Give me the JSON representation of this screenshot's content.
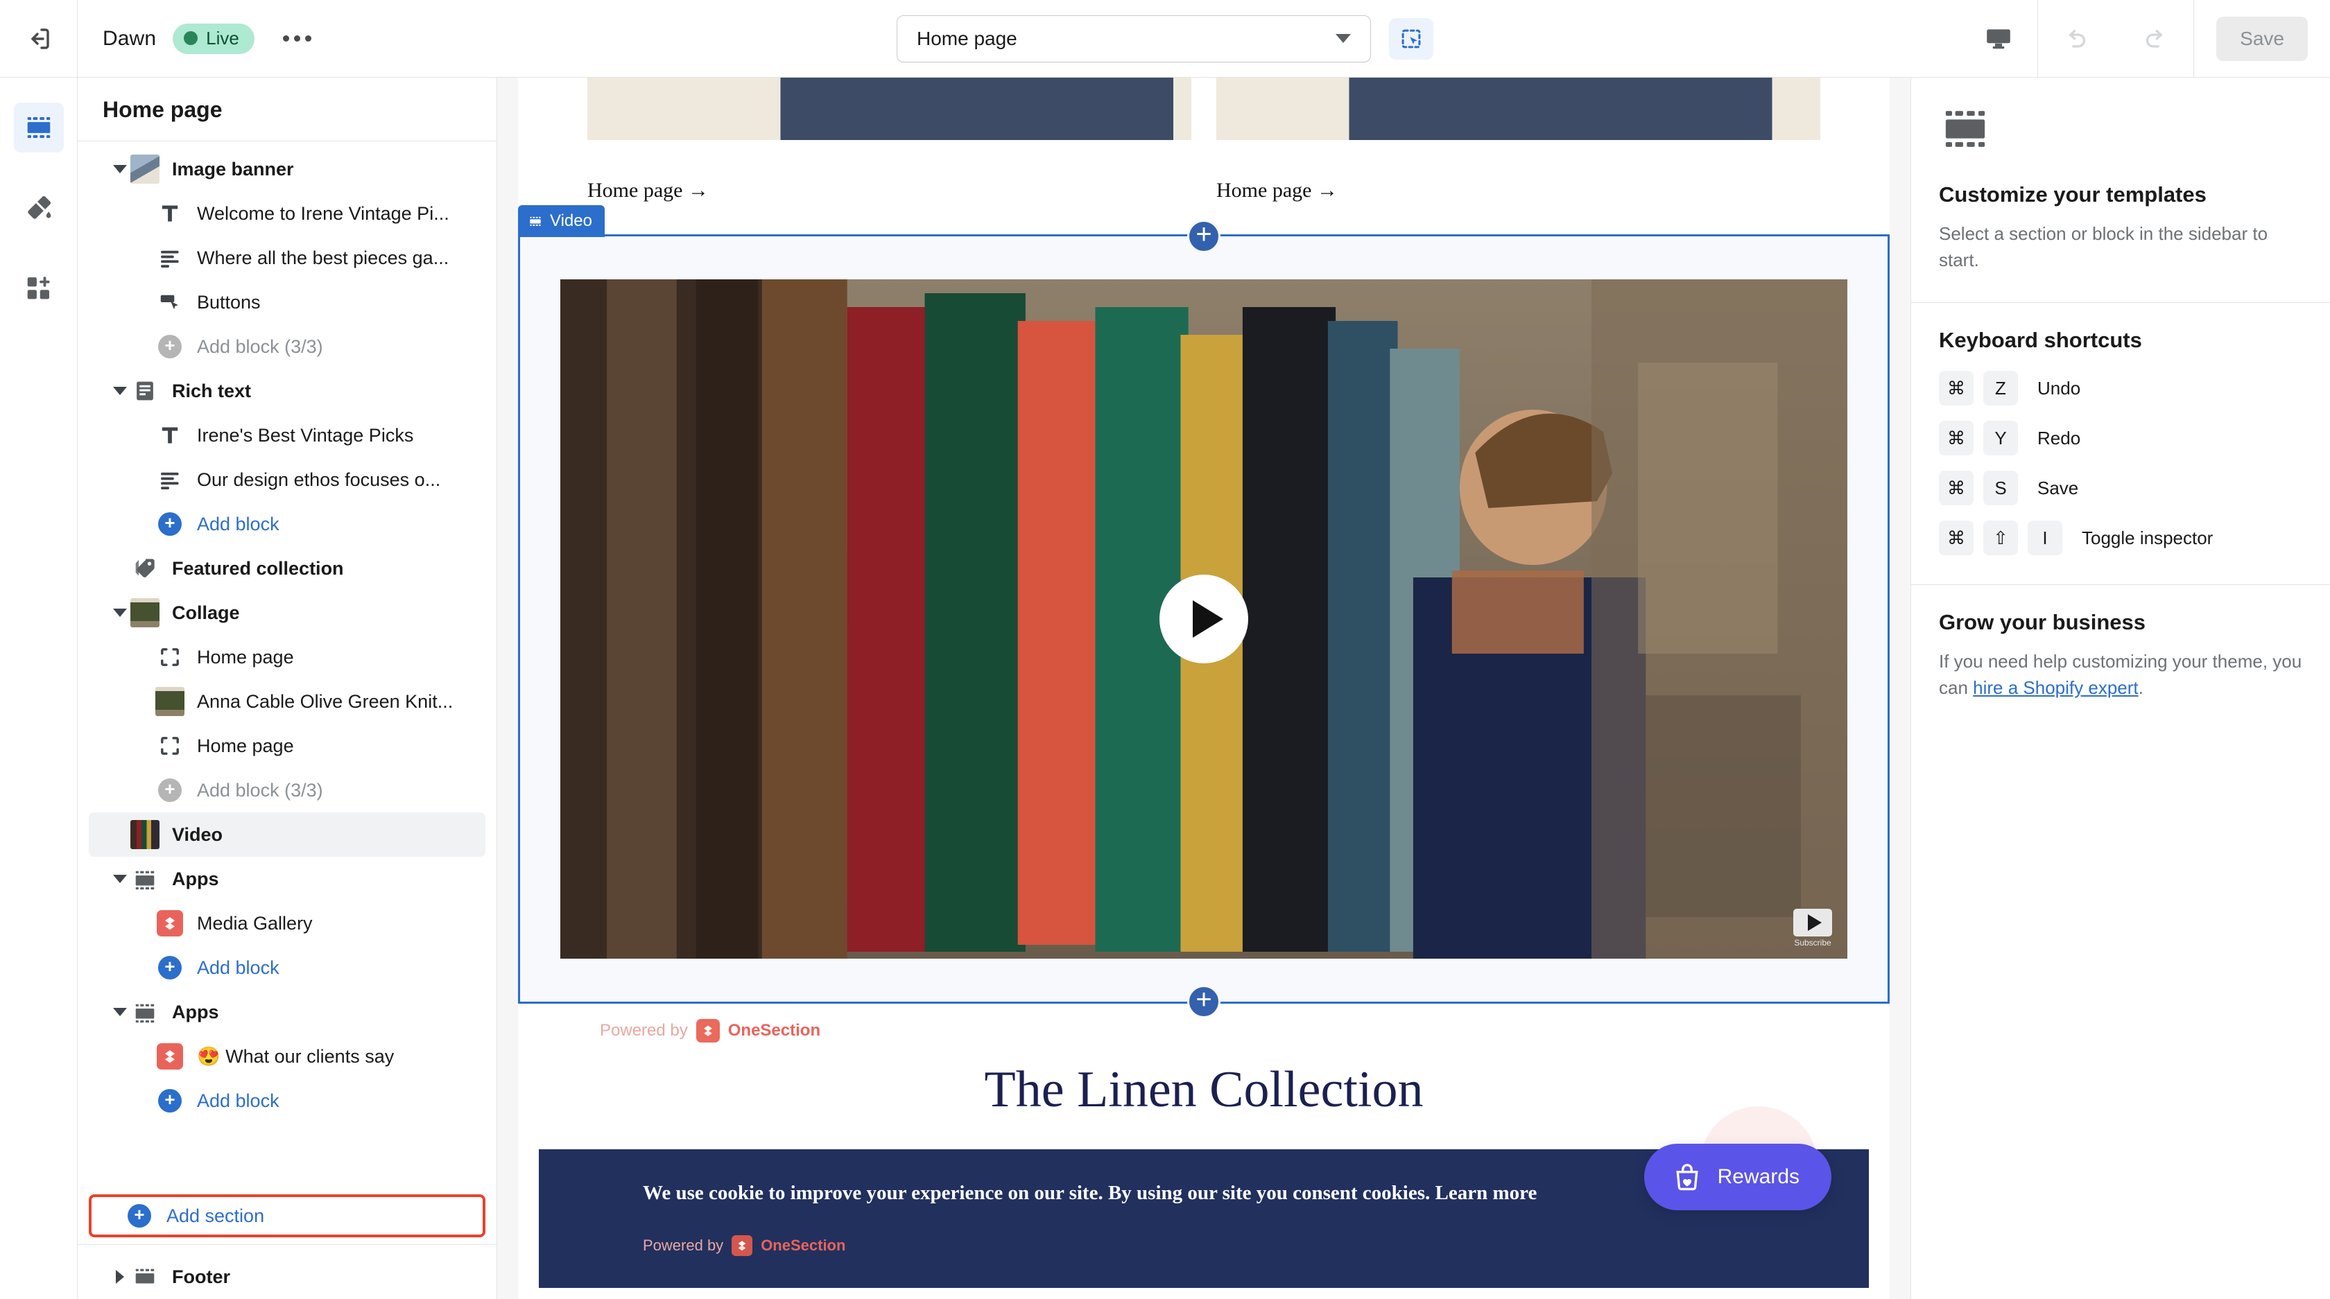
{
  "topbar": {
    "exit_icon": "exit-icon",
    "theme_name": "Dawn",
    "status_badge": "Live",
    "more_icon": "more-menu-icon",
    "page_selector_value": "Home page",
    "select_tool_icon": "section-select-icon",
    "device_icon": "desktop-preview-icon",
    "undo_icon": "undo-icon",
    "redo_icon": "redo-icon",
    "save_label": "Save"
  },
  "rail": {
    "items": [
      {
        "name": "sections-icon",
        "label": "Sections",
        "active": true
      },
      {
        "name": "theme-settings-brush-icon",
        "label": "Theme settings",
        "active": false
      },
      {
        "name": "app-embeds-icon",
        "label": "App embeds",
        "active": false
      }
    ]
  },
  "sidebar": {
    "title": "Home page",
    "add_section_label": "Add section",
    "tree": [
      {
        "type": "section",
        "label": "Image banner",
        "icon": "image-thumb",
        "twisty": "down"
      },
      {
        "type": "block",
        "label": "Welcome to Irene Vintage Pi...",
        "icon": "text-icon"
      },
      {
        "type": "block",
        "label": "Where all the best pieces ga...",
        "icon": "paragraph-icon"
      },
      {
        "type": "block",
        "label": "Buttons",
        "icon": "button-icon"
      },
      {
        "type": "addblock",
        "label": "Add block (3/3)",
        "disabled": true
      },
      {
        "type": "section",
        "label": "Rich text",
        "icon": "rich-text-icon",
        "twisty": "down"
      },
      {
        "type": "block",
        "label": "Irene's Best Vintage Picks",
        "icon": "text-icon"
      },
      {
        "type": "block",
        "label": "Our design ethos focuses o...",
        "icon": "paragraph-icon"
      },
      {
        "type": "addblock",
        "label": "Add block",
        "disabled": false
      },
      {
        "type": "section",
        "label": "Featured collection",
        "icon": "tag-icon",
        "twisty": "none"
      },
      {
        "type": "section",
        "label": "Collage",
        "icon": "image-thumb-green",
        "twisty": "down"
      },
      {
        "type": "block",
        "label": "Home page",
        "icon": "frame-icon"
      },
      {
        "type": "block",
        "label": "Anna Cable Olive Green Knit...",
        "icon": "image-thumb-green"
      },
      {
        "type": "block",
        "label": "Home page",
        "icon": "frame-icon"
      },
      {
        "type": "addblock",
        "label": "Add block (3/3)",
        "disabled": true
      },
      {
        "type": "section",
        "label": "Video",
        "icon": "video-thumb",
        "twisty": "none",
        "selected": true
      },
      {
        "type": "section",
        "label": "Apps",
        "icon": "apps-icon",
        "twisty": "down"
      },
      {
        "type": "block",
        "label": "Media Gallery",
        "icon": "onesection-app-icon"
      },
      {
        "type": "addblock",
        "label": "Add block",
        "disabled": false
      },
      {
        "type": "section",
        "label": "Apps",
        "icon": "apps-icon",
        "twisty": "down"
      },
      {
        "type": "block",
        "label": "😍 What our clients say",
        "icon": "onesection-app-icon"
      },
      {
        "type": "addblock",
        "label": "Add block",
        "disabled": false
      }
    ],
    "footer_item": {
      "label": "Footer",
      "icon": "apps-icon",
      "twisty": "right"
    }
  },
  "preview": {
    "section_tag": "Video",
    "collage_links": [
      "Home page  →",
      "Home page  →"
    ],
    "play_button": "play-button",
    "yt_subscribe_caption": "Subscribe",
    "powered_by_prefix": "Powered by",
    "powered_by_brand": "OneSection",
    "linen_title": "The Linen Collection",
    "cookie_text": "We use cookie to improve your experience on our site. By using our site you consent cookies.",
    "cookie_learn_more": "Learn more",
    "cookie_powered_prefix": "Powered by",
    "cookie_powered_brand": "OneSection",
    "rewards_label": "Rewards"
  },
  "inspector": {
    "empty_title": "Customize your templates",
    "empty_sub": "Select a section or block in the sidebar to start.",
    "shortcuts_title": "Keyboard shortcuts",
    "shortcuts": [
      {
        "keys": [
          "⌘",
          "Z"
        ],
        "label": "Undo"
      },
      {
        "keys": [
          "⌘",
          "Y"
        ],
        "label": "Redo"
      },
      {
        "keys": [
          "⌘",
          "S"
        ],
        "label": "Save"
      },
      {
        "keys": [
          "⌘",
          "⇧",
          "I"
        ],
        "label": "Toggle inspector"
      }
    ],
    "grow_title": "Grow your business",
    "grow_text_before": "If you need help customizing your theme, you can ",
    "grow_link": "hire a Shopify expert",
    "grow_text_after": "."
  },
  "colors": {
    "accent_blue": "#2c6ecb",
    "live_green": "#aee9d1",
    "highlight_red": "#e8432c",
    "cookie_navy": "#22305e",
    "rewards_purple": "#5b54e8",
    "onesection_red": "#ea6a5c"
  }
}
